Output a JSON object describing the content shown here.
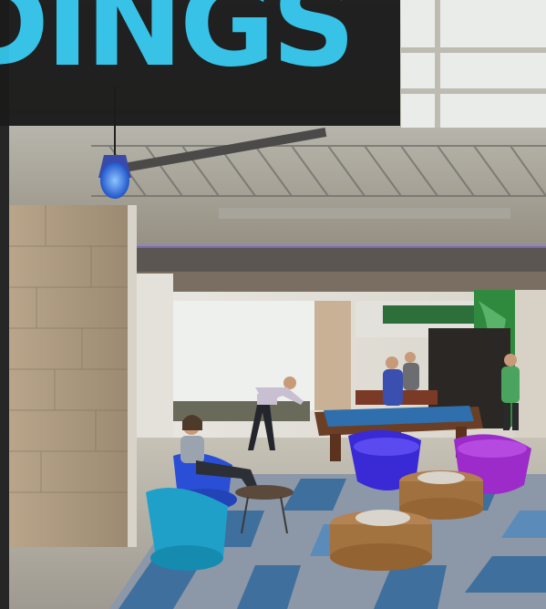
{
  "banner": {
    "title_fragment": "DINGS",
    "accent_color": "#33c2e8",
    "background_color": "#1b1b1b"
  },
  "photo": {
    "subject": "office-lounge-with-pool-table"
  }
}
